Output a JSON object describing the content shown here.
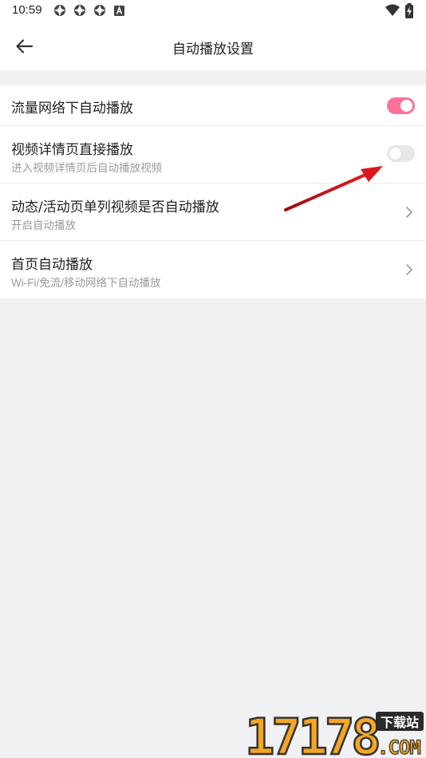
{
  "status_bar": {
    "time": "10:59"
  },
  "header": {
    "title": "自动播放设置",
    "back_icon": "arrow-left-icon"
  },
  "settings": [
    {
      "title": "流量网络下自动播放",
      "subtitle": "",
      "control": "toggle",
      "enabled": true
    },
    {
      "title": "视频详情页直接播放",
      "subtitle": "进入视频详情页后自动播放视频",
      "control": "toggle",
      "enabled": false
    },
    {
      "title": "动态/活动页单列视频是否自动播放",
      "subtitle": "开启自动播放",
      "control": "chevron"
    },
    {
      "title": "首页自动播放",
      "subtitle": "Wi-Fi/免流/移动网络下自动播放",
      "control": "chevron"
    }
  ],
  "colors": {
    "accent": "#fb7299",
    "toggle_off": "#e7e7e7",
    "background": "#f0f1f3",
    "arrow": "#d9161b"
  },
  "watermark": {
    "number": "17178",
    "tagline": "下载站",
    "domain": ".COM"
  }
}
